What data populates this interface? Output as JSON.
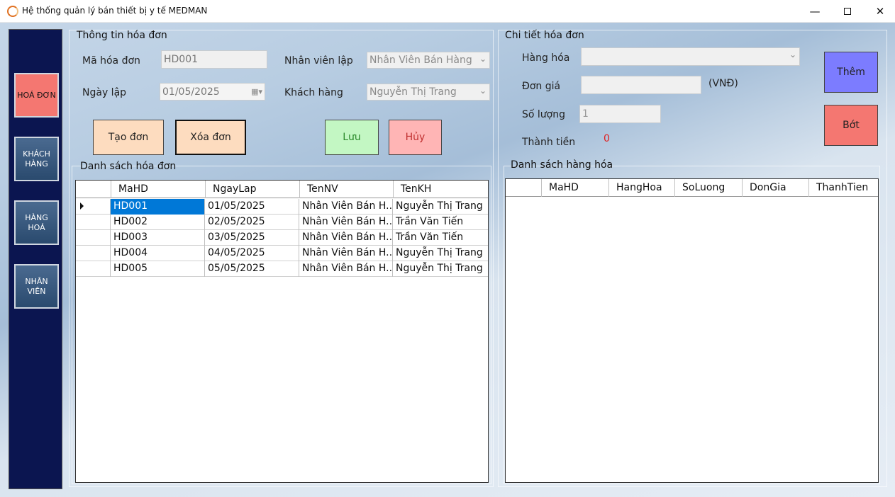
{
  "window": {
    "title": "Hệ thống quản lý bán thiết bị y tế MEDMAN",
    "minimize": "—",
    "close": "✕"
  },
  "sidebar": {
    "items": [
      {
        "label": "HOÁ ĐƠN"
      },
      {
        "label": "KHÁCH HÀNG"
      },
      {
        "label": "HÀNG HOÁ"
      },
      {
        "label": "NHÂN VIÊN"
      }
    ]
  },
  "invoice_info": {
    "title": "Thông tin hóa đơn",
    "ma_label": "Mã hóa đơn",
    "ma_value": "HD001",
    "ngay_label": "Ngày lập",
    "ngay_value": "01/05/2025",
    "nv_label": "Nhân viên lập",
    "nv_value": "Nhân Viên Bán Hàng",
    "kh_label": "Khách hàng",
    "kh_value": "Nguyễn Thị Trang",
    "btn_tao": "Tạo đơn",
    "btn_xoa": "Xóa đơn",
    "btn_luu": "Lưu",
    "btn_huy": "Hủy"
  },
  "invoice_list": {
    "title": "Danh sách hóa đơn",
    "columns": [
      "MaHD",
      "NgayLap",
      "TenNV",
      "TenKH"
    ],
    "rows": [
      [
        "HD001",
        "01/05/2025",
        "Nhân Viên Bán H...",
        "Nguyễn Thị Trang"
      ],
      [
        "HD002",
        "02/05/2025",
        "Nhân Viên Bán H...",
        "Trần Văn Tiến"
      ],
      [
        "HD003",
        "03/05/2025",
        "Nhân Viên Bán H...",
        "Trần Văn Tiến"
      ],
      [
        "HD004",
        "04/05/2025",
        "Nhân Viên Bán H...",
        "Nguyễn Thị Trang"
      ],
      [
        "HD005",
        "05/05/2025",
        "Nhân Viên Bán H...",
        "Nguyễn Thị Trang"
      ]
    ]
  },
  "detail": {
    "title": "Chi tiết hóa đơn",
    "hanghoa_label": "Hàng hóa",
    "hanghoa_value": "",
    "dongia_label": "Đơn giá",
    "dongia_value": "",
    "unit": "(VNĐ)",
    "soluong_label": "Số lượng",
    "soluong_value": "1",
    "thanhtien_label": "Thành tiền",
    "thanhtien_value": "0",
    "btn_them": "Thêm",
    "btn_bot": "Bớt"
  },
  "item_list": {
    "title": "Danh sách hàng hóa",
    "columns": [
      "MaHD",
      "HangHoa",
      "SoLuong",
      "DonGia",
      "ThanhTien"
    ]
  }
}
